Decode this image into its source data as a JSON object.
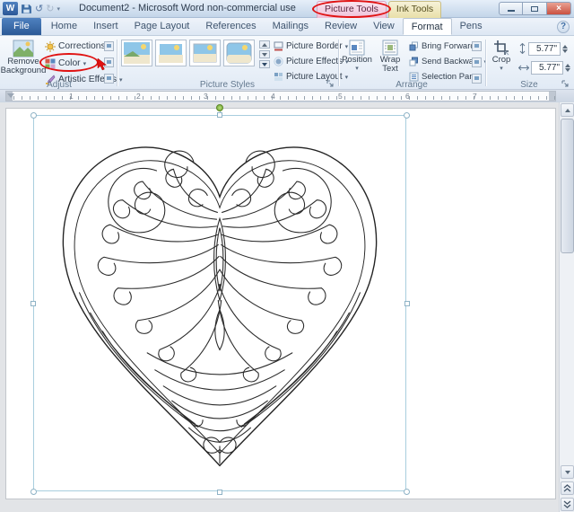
{
  "titlebar": {
    "title": "Document2 - Microsoft Word non-commercial use",
    "picture_tools": "Picture Tools",
    "ink_tools": "Ink Tools",
    "close_glyph": "×",
    "undo_glyph": "↺",
    "redo_glyph": "↻",
    "qat_drop_glyph": "▾",
    "logo_letter": "W"
  },
  "help_glyph": "?",
  "tabs": {
    "file": "File",
    "home": "Home",
    "insert": "Insert",
    "page_layout": "Page Layout",
    "references": "References",
    "mailings": "Mailings",
    "review": "Review",
    "view": "View",
    "format": "Format",
    "pens": "Pens"
  },
  "adjust": {
    "label": "Adjust",
    "remove_line1": "Remove",
    "remove_line2": "Background",
    "corrections": "Corrections",
    "color": "Color",
    "artistic_effects": "Artistic Effects"
  },
  "picture_styles": {
    "label": "Picture Styles",
    "border": "Picture Border",
    "effects": "Picture Effects",
    "layout": "Picture Layout"
  },
  "arrange": {
    "label": "Arrange",
    "position": "Position",
    "wrap_line1": "Wrap",
    "wrap_line2": "Text",
    "bring_forward": "Bring Forward",
    "send_backward": "Send Backward",
    "selection_pane": "Selection Pane"
  },
  "size": {
    "label": "Size",
    "crop": "Crop",
    "height_value": "5.77\"",
    "width_value": "5.77\""
  },
  "ruler": {
    "numbers": [
      "1",
      "2",
      "3",
      "4",
      "5",
      "6",
      "7"
    ]
  },
  "accent_colors": {
    "annotation_red": "#e01212",
    "selection_teal": "#a9cede",
    "rotation_green": "#6f9f33"
  }
}
